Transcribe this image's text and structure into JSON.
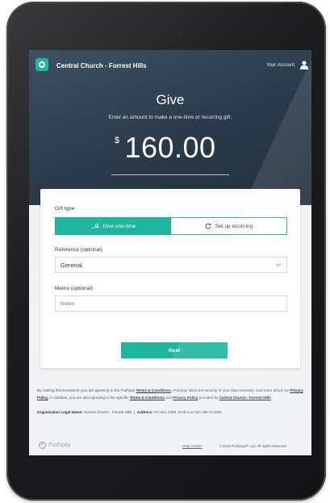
{
  "header": {
    "org_name": "Central Church - Forrest Hills",
    "account_label": "Your Account"
  },
  "hero": {
    "title": "Give",
    "subtitle": "Enter an amount to make a one-time or recurring gift.",
    "currency_symbol": "$",
    "amount": "160.00"
  },
  "form": {
    "gift_type_label": "Gift type",
    "gift_type_options": [
      {
        "label": "Give one-time",
        "selected": true
      },
      {
        "label": "Set up recurring",
        "selected": false
      }
    ],
    "reference_label": "Reference (optional)",
    "reference_value": "General",
    "memo_label": "Memo (optional)",
    "memo_placeholder": "Notes",
    "next_label": "Next"
  },
  "legal": {
    "text_1": "By making this transaction you are agreeing to the Pushpay",
    "terms_link": "Terms & Conditions",
    "text_2": ". Pushpay takes the security of your data seriously, read more about our",
    "privacy_link": "Privacy Policy",
    "text_3": ". In addition, you are also agreeing to the specific",
    "org_terms_link": "Terms & Conditions",
    "text_4": "and",
    "org_privacy_link": "Privacy Policy",
    "text_5": "provided by",
    "org_link": "Central Church - Forrest Hills",
    "text_6": ".",
    "legal_name_label": "Organization Legal Name:",
    "legal_name_value": "Central Church - Forrest Hills",
    "address_label": "Address:",
    "address_value": "PO Box 2088, Redmond WA 98073-2088"
  },
  "footer": {
    "brand": "Pushpay",
    "help_label": "Help Center",
    "copyright": "©2016 Pushpay® Ltd, All rights reserved"
  },
  "colors": {
    "accent": "#1fb59e",
    "hero_bg": "#2a3a4b",
    "device_frame": "#1c1c1e"
  }
}
